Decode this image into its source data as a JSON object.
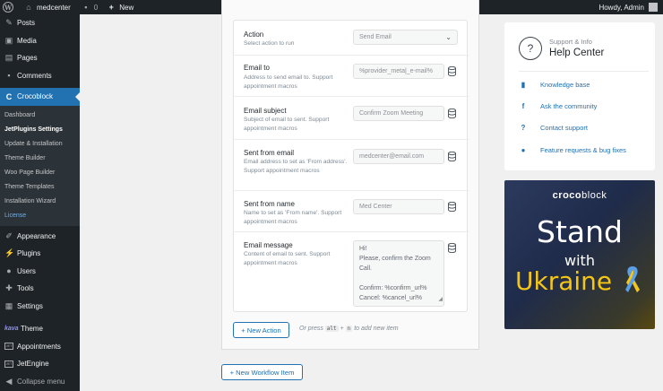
{
  "adminbar": {
    "site_name": "medcenter",
    "comments_count": "0",
    "new_label": "New",
    "howdy": "Howdy, Admin"
  },
  "sidebar": {
    "items_top": [
      {
        "label": "Posts",
        "icon": "pin-icon"
      },
      {
        "label": "Media",
        "icon": "media-icon"
      },
      {
        "label": "Pages",
        "icon": "pages-icon"
      },
      {
        "label": "Comments",
        "icon": "comments-icon"
      }
    ],
    "active_item": {
      "label": "Crocoblock",
      "icon": "crocoblock-icon"
    },
    "submenu": [
      "Dashboard",
      "JetPlugins Settings",
      "Update & Installation",
      "Theme Builder",
      "Woo Page Builder",
      "Theme Templates",
      "Installation Wizard",
      "License"
    ],
    "items_bottom": [
      {
        "label": "Appearance",
        "icon": "brush-icon"
      },
      {
        "label": "Plugins",
        "icon": "plugin-icon"
      },
      {
        "label": "Users",
        "icon": "user-icon"
      },
      {
        "label": "Tools",
        "icon": "wrench-icon"
      },
      {
        "label": "Settings",
        "icon": "settings-icon"
      }
    ],
    "theme_label": "Theme",
    "theme_logo": "kava",
    "appointments_label": "Appointments",
    "jetengine_label": "JetEngine",
    "collapse_label": "Collapse menu"
  },
  "action_form": {
    "action": {
      "title": "Action",
      "desc": "Select action to run",
      "value": "Send Email"
    },
    "email_to": {
      "title": "Email to",
      "desc": "Address to send email to. Support appointment macros",
      "value": "%provider_meta|_e-mail%"
    },
    "email_subject": {
      "title": "Email subject",
      "desc": "Subject of email to sent. Support appointment macros",
      "value": "Confirm Zoom Meeting"
    },
    "sent_from_email": {
      "title": "Sent from email",
      "desc": "Email address to set as 'From address'. Support appointment macros",
      "value": "medcenter@email.com"
    },
    "sent_from_name": {
      "title": "Sent from name",
      "desc": "Name to set as 'From name'. Support appointment macros",
      "value": "Med Center"
    },
    "email_message": {
      "title": "Email message",
      "desc": "Content of email to sent. Support appointment macros",
      "lines": [
        "Hi!",
        "Please, confirm the Zoom Call.",
        "",
        "Confirm: %confirm_url%",
        "Cancel: %cancel_url%"
      ]
    }
  },
  "new_action_label": "+ New Action",
  "hint": {
    "prefix": "Or press",
    "key1": "alt",
    "plus": "+",
    "key2": "n",
    "suffix": "to add new item"
  },
  "new_workflow_label": "+ New Workflow Item",
  "help": {
    "subtitle": "Support & Info",
    "title": "Help Center",
    "links": [
      {
        "label": "Knowledge base",
        "icon": "book-icon"
      },
      {
        "label": "Ask the community",
        "icon": "facebook-icon"
      },
      {
        "label": "Contact support",
        "icon": "question-icon"
      },
      {
        "label": "Feature requests & bug fixes",
        "icon": "github-icon"
      }
    ]
  },
  "banner": {
    "logo_bold": "croco",
    "logo_thin": "block",
    "line1": "Stand",
    "line2": "with",
    "line3": "Ukraine",
    "colors": {
      "blue": "#2c3a5e",
      "yellow": "#f5c518"
    }
  },
  "colors": {
    "accent": "#2271b1",
    "sidebar": "#1d2327",
    "active": "#2271b1"
  }
}
